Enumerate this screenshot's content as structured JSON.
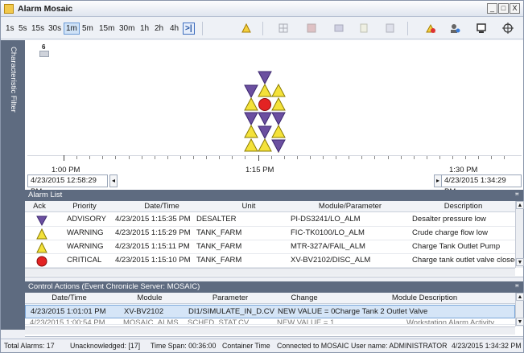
{
  "window": {
    "title": "Alarm Mosaic",
    "controls": [
      "_",
      "□",
      "X"
    ]
  },
  "toolbar": {
    "timespans": [
      "1s",
      "5s",
      "15s",
      "30s",
      "1m",
      "5m",
      "15m",
      "30m",
      "1h",
      "2h",
      "4h"
    ],
    "selected_timespan": "1m",
    "end_button_label": ">|",
    "icons": [
      "highlight-icon",
      "grid-icon",
      "filter-icon",
      "table-icon",
      "note-icon",
      "export-icon",
      "acknowledge-icon",
      "user-settings-icon",
      "display-icon",
      "crosshair-icon"
    ]
  },
  "sidebar": {
    "label": "Characteristic Filter"
  },
  "mosaic": {
    "count_badge": "6",
    "time_labels": [
      "1:00 PM",
      "1:15 PM",
      "1:30 PM"
    ],
    "range_start": "4/23/2015 12:58:29 PM",
    "range_end": "4/23/2015 1:34:29 PM",
    "scroll_left": "◂",
    "scroll_right": "▸",
    "legend_colors": {
      "advisory": "#6b4fa0",
      "warning": "#f4e23a",
      "critical": "#e32323"
    }
  },
  "alarm_list": {
    "title": "Alarm List",
    "pin": "ꟸ",
    "columns": [
      "Ack",
      "Priority",
      "Date/Time",
      "Unit",
      "Module/Parameter",
      "Description"
    ],
    "rows": [
      {
        "shape": "advisory",
        "priority": "ADVISORY",
        "datetime": "4/23/2015 1:15:35 PM",
        "unit": "DESALTER",
        "module": "PI-DS3241/LO_ALM",
        "description": "Desalter pressure low"
      },
      {
        "shape": "warning",
        "priority": "WARNING",
        "datetime": "4/23/2015 1:15:29 PM",
        "unit": "TANK_FARM",
        "module": "FIC-TK0100/LO_ALM",
        "description": "Crude charge flow low"
      },
      {
        "shape": "warning",
        "priority": "WARNING",
        "datetime": "4/23/2015 1:15:11 PM",
        "unit": "TANK_FARM",
        "module": "MTR-327A/FAIL_ALM",
        "description": "Charge Tank Outlet Pump"
      },
      {
        "shape": "critical",
        "priority": "CRITICAL",
        "datetime": "4/23/2015 1:15:10 PM",
        "unit": "TANK_FARM",
        "module": "XV-BV2102/DISC_ALM",
        "description": "Charge tank outlet valve closed"
      }
    ]
  },
  "control_actions": {
    "title": "Control Actions (Event Chronicle Server: MOSAIC)",
    "pin": "ꟸ",
    "columns": [
      "Date/Time",
      "Module",
      "Parameter",
      "Change",
      "Module Description"
    ],
    "rows": [
      {
        "datetime": "4/23/2015 1:01:01 PM",
        "module": "XV-BV2102",
        "parameter": "DI1/SIMULATE_IN_D.CV",
        "change": "NEW VALUE = 0",
        "description": "Charge Tank 2 Outlet Valve"
      },
      {
        "datetime": "4/23/2015 1:00:54 PM",
        "module": "MOSAIC_ALMS",
        "parameter": "SCHED_STAT.CV",
        "change": "NEW VALUE = 1",
        "description": "Workstation Alarm Activity"
      }
    ]
  },
  "status_bar": {
    "total_alarms": "Total Alarms: 17",
    "unacknowledged": "Unacknowledged: [17]",
    "time_span": "Time Span: 00:36:00",
    "container_time": "Container Time",
    "connection": "Connected to MOSAIC",
    "user": "User name: ADMINISTRATOR",
    "timestamp": "4/23/2015 1:34:32 PM"
  }
}
